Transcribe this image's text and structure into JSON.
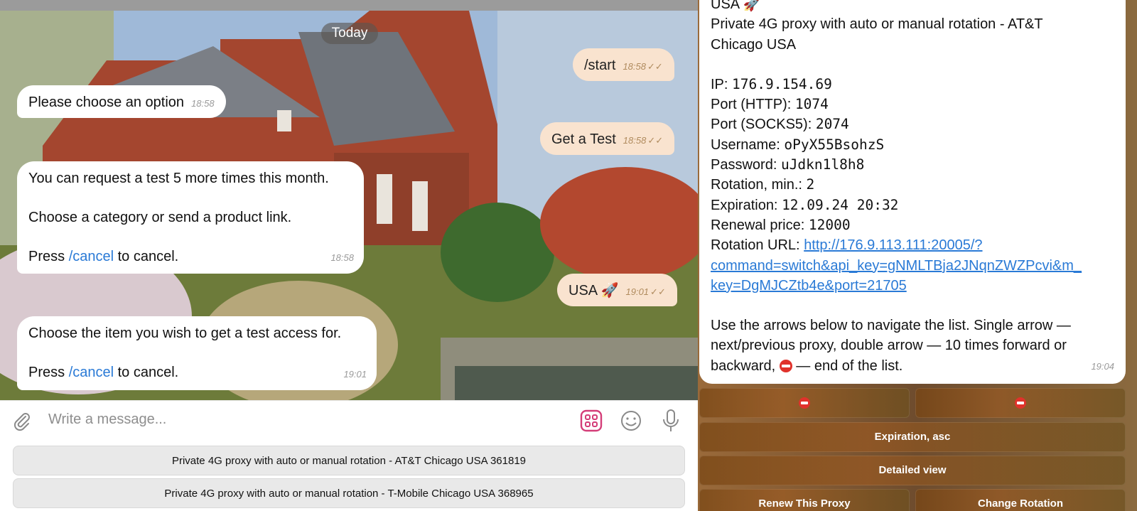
{
  "left_chat": {
    "date_pill": "Today",
    "messages": [
      {
        "side": "out",
        "text": "/start",
        "time": "18:58",
        "ticks": "✓✓"
      },
      {
        "side": "in",
        "text": "Please choose an option",
        "time": "18:58"
      },
      {
        "side": "out",
        "text": "Get a Test",
        "time": "18:58",
        "ticks": "✓✓"
      },
      {
        "side": "in",
        "line1": "You can request a test 5 more times this month.",
        "line2": "Choose a category or send a product link.",
        "press": "Press",
        "cmd": "/cancel",
        "tail": "to cancel.",
        "time": "18:58"
      },
      {
        "side": "out",
        "text": "USA",
        "emoji": "🚀",
        "time": "19:01",
        "ticks": "✓✓"
      },
      {
        "side": "in",
        "line1": "Choose the item you wish to get a test access for.",
        "press": "Press",
        "cmd": "/cancel",
        "tail": "to cancel.",
        "time": "19:01"
      }
    ],
    "composer": {
      "placeholder": "Write a message..."
    },
    "keyboard": [
      "Private 4G proxy with auto or manual rotation - AT&T Chicago USA 361819",
      "Private 4G proxy with auto or manual rotation - T-Mobile Chicago USA 368965"
    ]
  },
  "right_chat": {
    "header_partial": "USA",
    "title_line1": "Private 4G proxy with auto or manual rotation - AT&T",
    "title_line2": "Chicago USA",
    "fields": {
      "ip_label": "IP:",
      "ip": "176.9.154.69",
      "port_http_label": "Port (HTTP):",
      "port_http": "1074",
      "port_socks_label": "Port (SOCKS5):",
      "port_socks": "2074",
      "username_label": "Username:",
      "username": "oPyX55BsohzS",
      "password_label": "Password:",
      "password": "uJdkn1l8h8",
      "rotation_label": "Rotation, min.:",
      "rotation": "2",
      "expiration_label": "Expiration:",
      "expiration": "12.09.24 20:32",
      "renewal_label": "Renewal price:",
      "renewal": "12000",
      "rotation_url_label": "Rotation URL:",
      "rotation_url_1": "http://176.9.113.111:20005/?",
      "rotation_url_2": "command=switch&api_key=gNMLTBja2JNqnZWZPcvi&m_",
      "rotation_url_3": "key=DgMJCZtb4e&port=21705"
    },
    "help_line1": "Use the arrows below to navigate the list. Single arrow —",
    "help_line2": "next/previous proxy, double arrow — 10 times forward or",
    "help_line3a": "backward,",
    "help_line3b": "— end of the list.",
    "time": "19:04",
    "buttons": {
      "expiration_asc": "Expiration, asc",
      "detailed_view": "Detailed view",
      "renew": "Renew This Proxy",
      "change_rotation": "Change Rotation"
    }
  },
  "colors": {
    "accent_link": "#2a7ad6",
    "outgoing_bubble": "#f9e3cf",
    "stop_red": "#e0322b"
  }
}
